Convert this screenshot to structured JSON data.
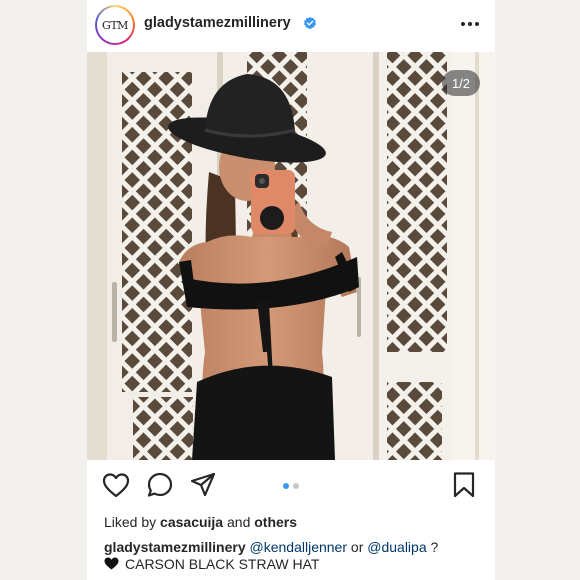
{
  "post": {
    "avatar_monogram": "GTM",
    "username": "gladystamezmillinery",
    "verified_icon": "verified-badge-icon",
    "more_icon": "more-horizontal-icon",
    "photo_counter": "1/2",
    "photo_subject": "Woman in black cowboy hat taking mirror selfie"
  },
  "actions": {
    "icons": [
      "heart-icon",
      "comment-icon",
      "share-icon",
      "bookmark-icon"
    ],
    "carousel_total": 2,
    "carousel_active": 1
  },
  "likes": {
    "prefix": "Liked by",
    "user": "casacuija",
    "middle": "and",
    "others": "others"
  },
  "caption": {
    "username": "gladystamezmillinery",
    "mention1": "@kendalljenner",
    "conjunction": "or",
    "mention2": "@dualipa",
    "question": "?",
    "emoji": "black-heart-icon",
    "product": "CARSON BLACK STRAW HAT"
  },
  "colors": {
    "accent_blue": "#3897f0",
    "mention_blue": "#00376b",
    "text": "#262626",
    "page_bg": "#f3f1ee"
  }
}
